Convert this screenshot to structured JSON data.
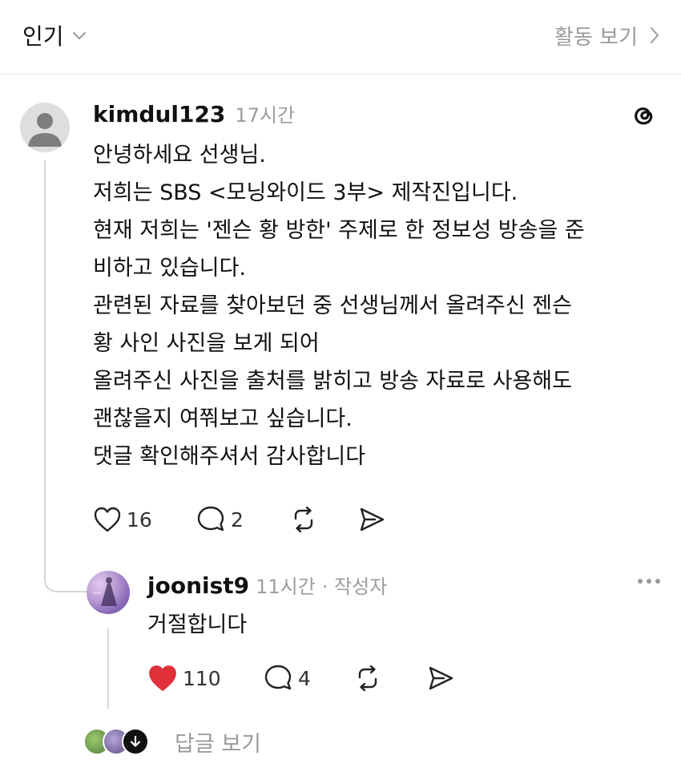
{
  "header": {
    "sort_label": "인기",
    "activity_label": "활동 보기"
  },
  "post": {
    "username": "kimdul123",
    "time": "17시간",
    "lines": [
      "안녕하세요 선생님.",
      "저희는 SBS <모닝와이드 3부> 제작진입니다.",
      "현재 저희는 '젠슨 황 방한' 주제로 한 정보성 방송을 준",
      "비하고 있습니다.",
      "관련된 자료를 찾아보던 중 선생님께서 올려주신 젠슨",
      "황 사인 사진을 보게 되어",
      "올려주신 사진을 출처를 밝히고 방송 자료로 사용해도",
      "괜찮을지 여쭤보고 싶습니다.",
      "댓글 확인해주셔서 감사합니다"
    ],
    "likes": "16",
    "replies": "2"
  },
  "reply": {
    "username": "joonist9",
    "time": "11시간",
    "badge": "· 작성자",
    "text": "거절합니다",
    "likes": "110",
    "replies": "4"
  },
  "view_replies_label": "답글 보기",
  "colors": {
    "heart_liked": "#e0303a",
    "muted_text": "#9d9d9d",
    "thread_line": "#d7d7d7"
  }
}
